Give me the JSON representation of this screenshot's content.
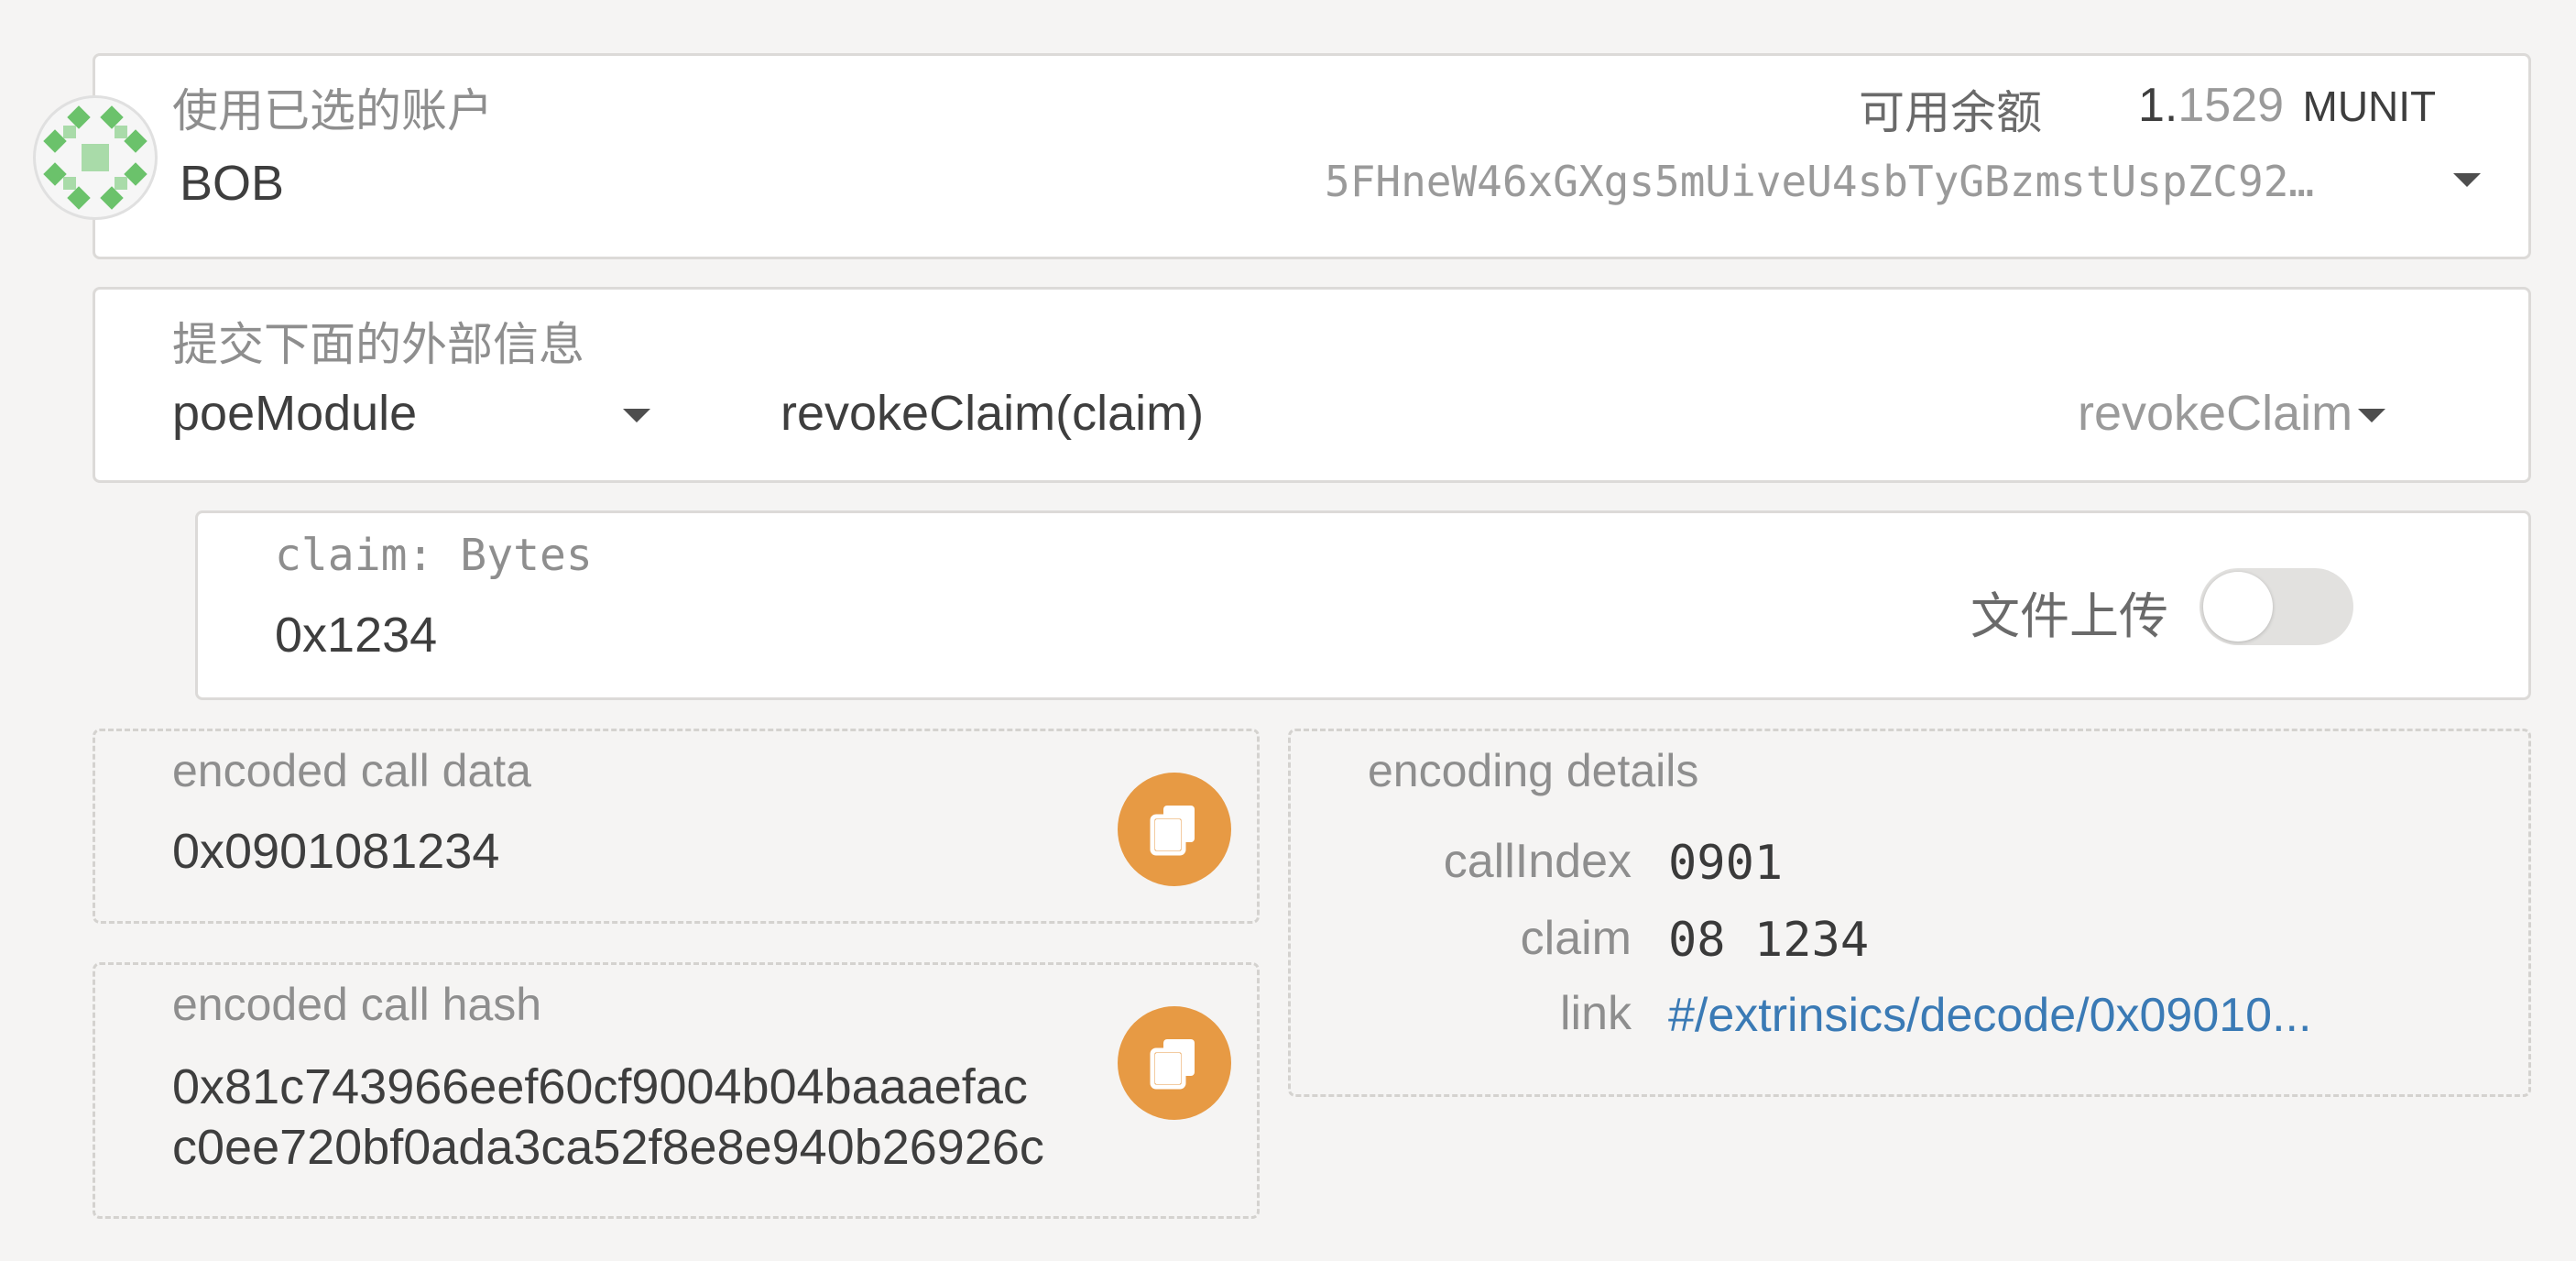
{
  "account": {
    "label": "使用已选的账户",
    "name": "BOB",
    "balance_label": "可用余额",
    "balance_int": "1.",
    "balance_frac": "1529",
    "balance_unit": "MUNIT",
    "address": "5FHneW46xGXgs5mUiveU4sbTyGBzmstUspZC92…"
  },
  "extrinsic": {
    "label": "提交下面的外部信息",
    "module": "poeModule",
    "call_signature": "revokeClaim(claim)",
    "call_name": "revokeClaim"
  },
  "param": {
    "label": "claim: Bytes",
    "value": "0x1234",
    "upload_label": "文件上传",
    "upload_enabled": false
  },
  "encoded": {
    "call_data_label": "encoded call data",
    "call_data": "0x0901081234",
    "call_hash_label": "encoded call hash",
    "call_hash_line1": "0x81c743966eef60cf9004b04baaaefac",
    "call_hash_line2": "c0ee720bf0ada3ca52f8e8e940b26926c"
  },
  "details": {
    "title": "encoding details",
    "rows": [
      {
        "key": "callIndex",
        "value": "0901"
      },
      {
        "key": "claim",
        "value": "08 1234"
      },
      {
        "key": "link",
        "value": "#/extrinsics/decode/0x09010..."
      }
    ]
  },
  "colors": {
    "accent": "#e79a44",
    "link": "#3a7ab5",
    "identicon": "#6bc26b"
  }
}
